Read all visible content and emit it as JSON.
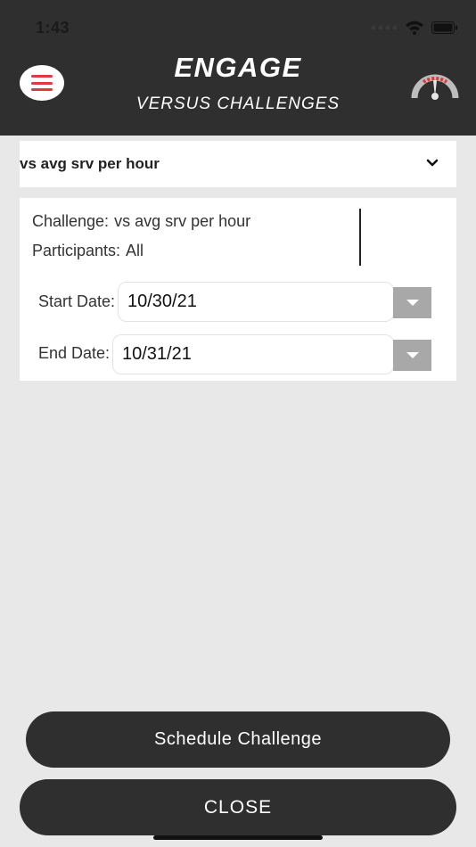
{
  "status_bar": {
    "time": "1:43"
  },
  "header": {
    "title": "ENGAGE",
    "subtitle": "VERSUS CHALLENGES"
  },
  "challenge_select": {
    "selected": "vs avg srv per hour"
  },
  "details": {
    "challenge_label": "Challenge:",
    "challenge_value": "vs avg srv per hour",
    "participants_label": "Participants:",
    "participants_value": "All",
    "start_label": "Start Date:",
    "start_value": "10/30/21",
    "end_label": "End Date:",
    "end_value": "10/31/21"
  },
  "actions": {
    "schedule_label": "Schedule Challenge",
    "close_label": "CLOSE"
  },
  "colors": {
    "header_bg": "#2f2f2f",
    "accent_red": "#e03a3a",
    "page_bg": "#e8e8e8",
    "arrow_gray": "#a8a8a8"
  }
}
